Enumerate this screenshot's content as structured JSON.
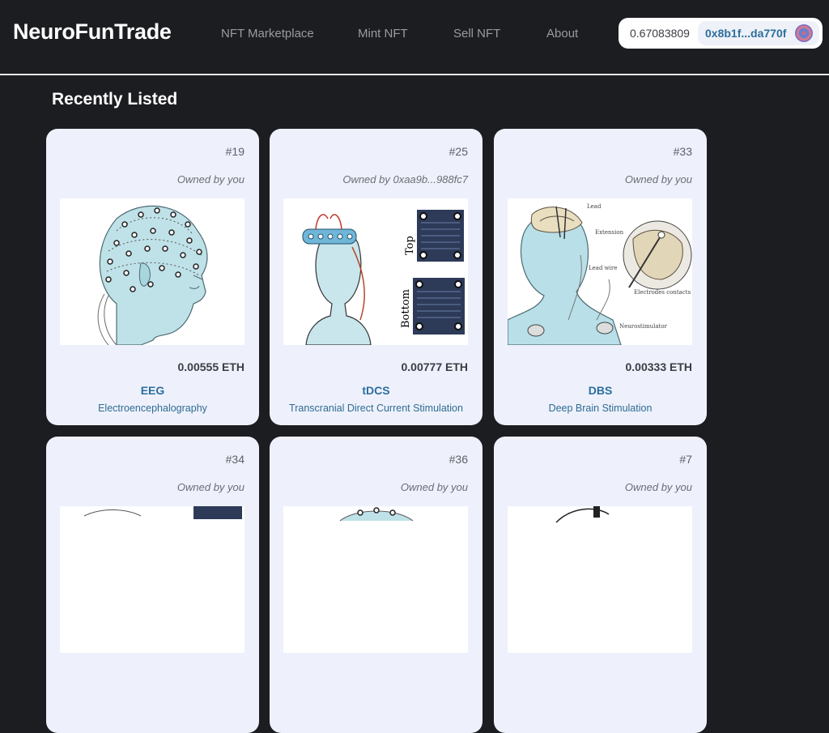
{
  "brand": "NeuroFunTrade",
  "nav": [
    {
      "label": "NFT Marketplace"
    },
    {
      "label": "Mint NFT"
    },
    {
      "label": "Sell NFT"
    },
    {
      "label": "About"
    }
  ],
  "wallet": {
    "balance": "0.67083809",
    "address": "0x8b1f...da770f"
  },
  "section_title": "Recently Listed",
  "cards": [
    {
      "id": "#19",
      "owner": "Owned by you",
      "price": "0.00555 ETH",
      "name": "EEG",
      "desc": "Electroencephalography"
    },
    {
      "id": "#25",
      "owner": "Owned by 0xaa9b...988fc7",
      "price": "0.00777 ETH",
      "name": "tDCS",
      "desc": "Transcranial Direct Current Stimulation",
      "image_text": {
        "top": "Top",
        "bottom": "Bottom"
      }
    },
    {
      "id": "#33",
      "owner": "Owned by you",
      "price": "0.00333 ETH",
      "name": "DBS",
      "desc": "Deep Brain Stimulation",
      "image_text": {
        "lead": "Lead",
        "extension": "Extension",
        "lead_wire": "Lead wire",
        "electrodes": "Electrodes contacts",
        "neurostimulator": "Neurostimulator"
      }
    },
    {
      "id": "#34",
      "owner": "Owned by you"
    },
    {
      "id": "#36",
      "owner": "Owned by you"
    },
    {
      "id": "#7",
      "owner": "Owned by you"
    }
  ],
  "colors": {
    "background": "#1c1d21",
    "card": "#eef1fb",
    "accent": "#2c6e9e"
  }
}
